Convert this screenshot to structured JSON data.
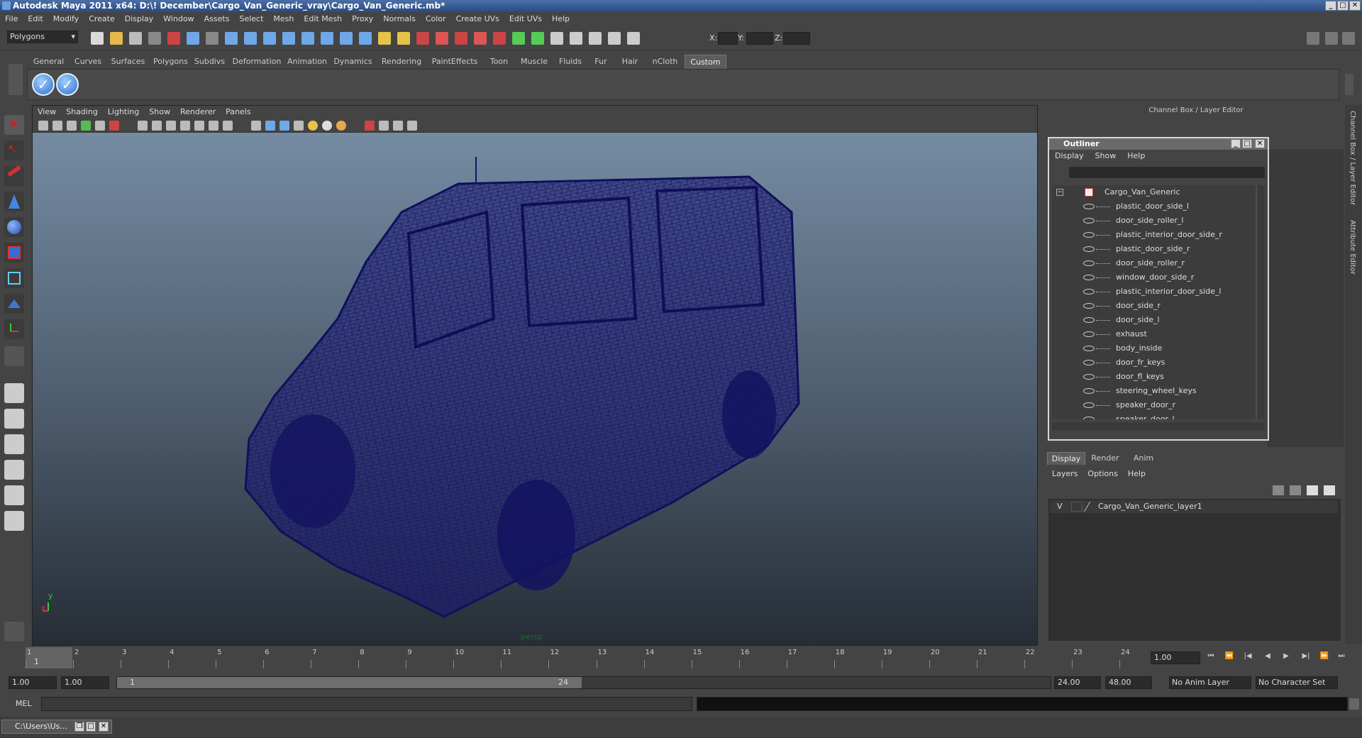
{
  "window": {
    "title": "Autodesk Maya 2011 x64: D:\\! December\\Cargo_Van_Generic_vray\\Cargo_Van_Generic.mb*"
  },
  "menubar": [
    "File",
    "Edit",
    "Modify",
    "Create",
    "Display",
    "Window",
    "Assets",
    "Select",
    "Mesh",
    "Edit Mesh",
    "Proxy",
    "Normals",
    "Color",
    "Create UVs",
    "Edit UVs",
    "Help"
  ],
  "statusline": {
    "mode": "Polygons",
    "x_label": "X:",
    "y_label": "Y:",
    "z_label": "Z:"
  },
  "shelf": {
    "tabs": [
      "General",
      "Curves",
      "Surfaces",
      "Polygons",
      "Subdivs",
      "Deformation",
      "Animation",
      "Dynamics",
      "Rendering",
      "PaintEffects",
      "Toon",
      "Muscle",
      "Fluids",
      "Fur",
      "Hair",
      "nCloth",
      "Custom"
    ],
    "active": "Custom"
  },
  "viewport": {
    "menu": [
      "View",
      "Shading",
      "Lighting",
      "Show",
      "Renderer",
      "Panels"
    ],
    "camera": "persp",
    "axis_x": "x",
    "axis_y": "y",
    "wire_color": "#1a1a7a"
  },
  "channel_box": {
    "title": "Channel Box / Layer Editor"
  },
  "outliner": {
    "title": "Outliner",
    "menu": [
      "Display",
      "Show",
      "Help"
    ],
    "root": "Cargo_Van_Generic",
    "items": [
      "plastic_door_side_l",
      "door_side_roller_l",
      "plastic_interior_door_side_r",
      "plastic_door_side_r",
      "door_side_roller_r",
      "window_door_side_r",
      "plastic_interior_door_side_l",
      "door_side_r",
      "door_side_l",
      "exhaust",
      "body_inside",
      "door_fr_keys",
      "door_fl_keys",
      "steering_wheel_keys",
      "speaker_door_r",
      "speaker_door_l"
    ]
  },
  "layers": {
    "tabs": [
      "Display",
      "Render",
      "Anim"
    ],
    "active": "Display",
    "menu": [
      "Layers",
      "Options",
      "Help"
    ],
    "visible_flag": "V",
    "layer_name": "Cargo_Van_Generic_layer1"
  },
  "side_tabs": [
    "Channel Box / Layer Editor",
    "Attribute Editor"
  ],
  "timeline": {
    "ticks": [
      "1",
      "2",
      "3",
      "4",
      "5",
      "6",
      "7",
      "8",
      "9",
      "10",
      "11",
      "12",
      "13",
      "14",
      "15",
      "16",
      "17",
      "18",
      "19",
      "20",
      "21",
      "22",
      "23",
      "24"
    ],
    "current_frame": "1",
    "current_field": "1.00"
  },
  "range": {
    "start": "1.00",
    "playback_start": "1.00",
    "slider_min": "1",
    "slider_max": "24",
    "playback_end": "24.00",
    "end": "48.00",
    "anim_layer": "No Anim Layer",
    "char_set": "No Character Set"
  },
  "cmd": {
    "label": "MEL"
  },
  "taskbar": {
    "item": "C:\\Users\\Us..."
  }
}
